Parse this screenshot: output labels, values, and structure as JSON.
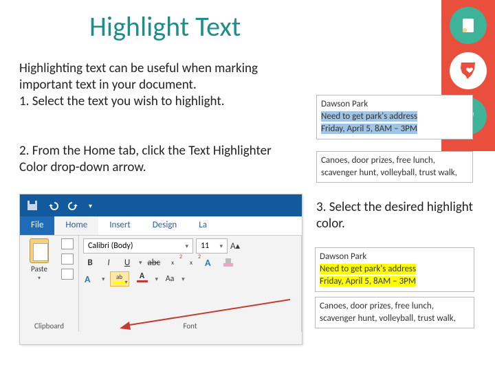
{
  "title": "Highlight Text",
  "intro": "Highlighting text can be useful when marking important text in your document.",
  "step1": "1.   Select the text you wish to highlight.",
  "step2": "2.  From the Home tab, click the Text Highlighter Color drop-down arrow.",
  "step3": "3.  Select the desired highlight color.",
  "sample": {
    "line1": "Dawson Park",
    "line2": "Need to get park's address",
    "line3": "Friday, April 5, 8AM – 3PM",
    "line4": "Canoes, door prizes, free lunch, scavenger hunt, volleyball, trust walk,"
  },
  "ribbon": {
    "tabs": {
      "file": "File",
      "home": "Home",
      "insert": "Insert",
      "design": "Design",
      "layout": "La"
    },
    "clipboard": {
      "paste": "Paste",
      "label": "Clipboard"
    },
    "font": {
      "name": "Calibri (Body)",
      "size": "11",
      "label": "Font",
      "buttons": {
        "bold": "B",
        "italic": "I",
        "underline": "U",
        "strike": "abc",
        "x2": "x",
        "A": "A",
        "ab": "ab",
        "Aa": "Aa"
      }
    }
  }
}
